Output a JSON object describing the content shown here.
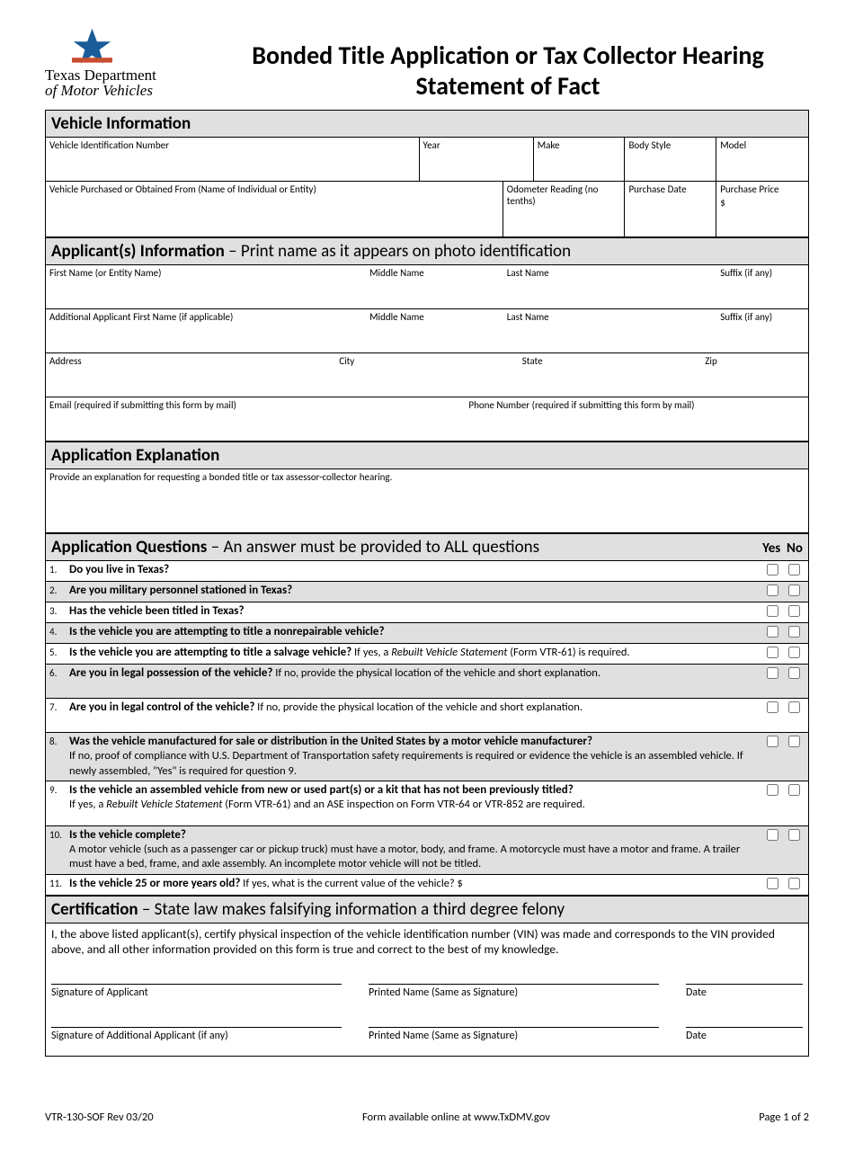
{
  "header": {
    "agency_l1": "Texas Department",
    "agency_l2": "of",
    "agency_l3": "Motor Vehicles",
    "title": "Bonded Title Application or Tax Collector Hearing Statement of Fact"
  },
  "sections": {
    "vehicle": {
      "title": "Vehicle Information",
      "fields": {
        "vin": "Vehicle Identification Number",
        "year": "Year",
        "make": "Make",
        "body": "Body Style",
        "model": "Model",
        "purchased_from": "Vehicle Purchased or Obtained From (Name of Individual or Entity)",
        "odometer": "Odometer Reading (no tenths)",
        "purchase_date": "Purchase Date",
        "purchase_price": "Purchase Price",
        "price_prefix": "$"
      }
    },
    "applicant": {
      "title": "Applicant(s) Information",
      "subtitle": " – Print name as it appears on photo identification",
      "fields": {
        "first": "First Name (or Entity Name)",
        "middle": "Middle Name",
        "last": "Last Name",
        "suffix": "Suffix (if any)",
        "add_first": "Additional Applicant First Name (if applicable)",
        "add_middle": "Middle Name",
        "add_last": "Last Name",
        "add_suffix": "Suffix (if any)",
        "address": "Address",
        "city": "City",
        "state": "State",
        "zip": "Zip",
        "email": "Email (required if submitting this form by mail)",
        "phone": "Phone Number (required if submitting this form by mail)"
      }
    },
    "explanation": {
      "title": "Application Explanation",
      "prompt": "Provide an explanation for requesting a bonded title or tax assessor-collector hearing."
    },
    "questions": {
      "title": "Application Questions",
      "subtitle": " – An answer must be provided to ALL questions",
      "yes": "Yes",
      "no": "No",
      "items": [
        {
          "n": "1.",
          "b": "Do you live in Texas?",
          "s": "",
          "shade": false
        },
        {
          "n": "2.",
          "b": "Are you military personnel stationed in Texas?",
          "s": "",
          "shade": true
        },
        {
          "n": "3.",
          "b": "Has the vehicle been titled in Texas?",
          "s": "",
          "shade": false
        },
        {
          "n": "4.",
          "b": "Is the vehicle you are attempting to title a nonrepairable vehicle?",
          "s": "",
          "shade": true
        },
        {
          "n": "5.",
          "b": "Is the vehicle you are attempting to title a salvage vehicle?",
          "s": " If yes, a Rebuilt Vehicle Statement (Form VTR-61) is required.",
          "shade": false,
          "ital": true
        },
        {
          "n": "6.",
          "b": "Are you in legal possession of the vehicle?",
          "s": " If no, provide the physical location of the vehicle and short explanation.",
          "shade": true,
          "tall": true
        },
        {
          "n": "7.",
          "b": "Are you in legal control of the vehicle?",
          "s": " If no, provide the physical location of the vehicle and short explanation.",
          "shade": false,
          "tall": true
        },
        {
          "n": "8.",
          "b": "Was the vehicle manufactured for sale or distribution in the United States by a motor vehicle manufacturer?",
          "s": "If no, proof of compliance with U.S. Department of Transportation safety requirements is required or evidence the vehicle is an assembled vehicle. If newly assembled, \"Yes\" is required for question 9.",
          "shade": true,
          "multi": true
        },
        {
          "n": "9.",
          "b": "Is the vehicle an assembled vehicle from new or used part(s) or a kit that has not been previously titled?",
          "s": "If yes, a Rebuilt Vehicle Statement (Form VTR-61) and an ASE inspection on Form VTR-64 or VTR-852 are required.",
          "shade": false,
          "multi": true,
          "ital": true
        },
        {
          "n": "10.",
          "b": "Is the vehicle complete?",
          "s": "A motor vehicle (such as a passenger car or pickup truck) must have a motor, body, and frame. A motorcycle must have a motor and frame. A trailer must have a bed, frame, and axle assembly. An incomplete motor vehicle will not be titled.",
          "shade": true,
          "multi": true
        },
        {
          "n": "11.",
          "b": "Is the vehicle 25 or more years old?",
          "s": " If yes, what is the current value of the vehicle? $",
          "shade": false
        }
      ]
    },
    "cert": {
      "title": "Certification",
      "subtitle": " – State law makes falsifying information a third degree felony",
      "body": "I, the above listed applicant(s), certify physical inspection of the vehicle identification number (VIN) was made and corresponds to the VIN provided above, and all other information provided on this form is true and correct to the best of my knowledge.",
      "sig1": "Signature of Applicant",
      "printed": "Printed Name (Same as Signature)",
      "date": "Date",
      "sig2": "Signature of Additional Applicant (if any)"
    }
  },
  "footer": {
    "left": "VTR-130-SOF Rev 03/20",
    "center": "Form available online at www.TxDMV.gov",
    "right": "Page 1 of 2"
  }
}
